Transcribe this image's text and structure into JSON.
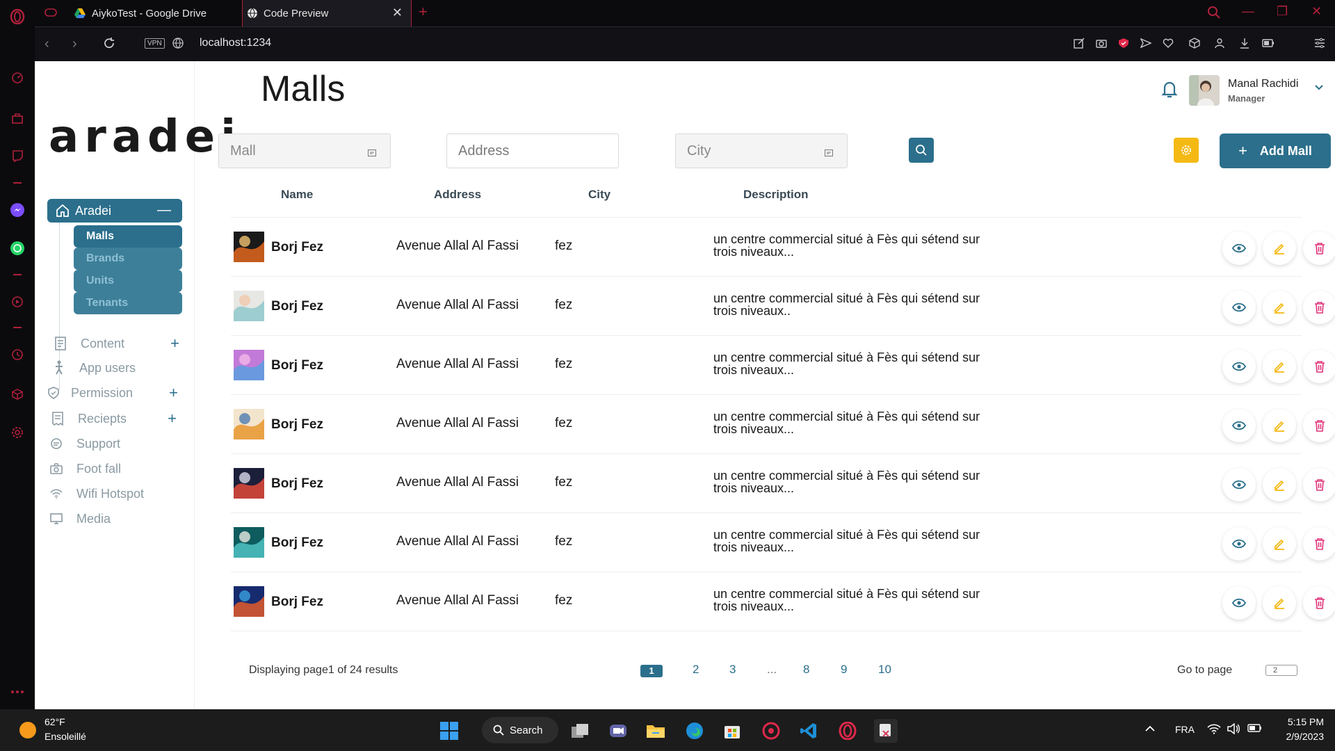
{
  "browser": {
    "tabs": [
      {
        "title": "AiykoTest - Google Drive",
        "active": false
      },
      {
        "title": "Code Preview",
        "active": true
      }
    ],
    "url": "localhost:1234",
    "vpn_label": "VPN"
  },
  "sidebar": {
    "logo": "aradei",
    "parent": {
      "label": "Aradei",
      "collapse": "—"
    },
    "sub_items": [
      {
        "label": "Malls",
        "active": true
      },
      {
        "label": "Brands",
        "active": false
      },
      {
        "label": "Units",
        "active": false
      },
      {
        "label": "Tenants",
        "active": false
      }
    ],
    "menu": [
      {
        "label": "Content",
        "icon": "document-icon",
        "has_plus": true
      },
      {
        "label": "App users",
        "icon": "person-icon",
        "has_plus": false
      },
      {
        "label": "Permission",
        "icon": "shield-icon",
        "has_plus": true
      },
      {
        "label": "Reciepts",
        "icon": "receipt-icon",
        "has_plus": true
      },
      {
        "label": "Support",
        "icon": "chat-icon",
        "has_plus": false
      },
      {
        "label": "Foot fall",
        "icon": "camera-icon",
        "has_plus": false
      },
      {
        "label": "Wifi Hotspot",
        "icon": "wifi-icon",
        "has_plus": false
      },
      {
        "label": "Media",
        "icon": "monitor-icon",
        "has_plus": false
      }
    ],
    "plus": "+"
  },
  "header": {
    "title": "Malls",
    "user_name": "Manal Rachidi",
    "user_role": "Manager"
  },
  "filters": {
    "mall_placeholder": "Mall",
    "address_placeholder": "Address",
    "city_placeholder": "City"
  },
  "toolbar": {
    "add_label": "Add Mall",
    "add_plus": "+"
  },
  "table": {
    "columns": [
      "Name",
      "Address",
      "City",
      "Description"
    ],
    "rows": [
      {
        "name": "Borj Fez",
        "address": "Avenue Allal Al Fassi",
        "city": "fez",
        "description": "un centre commercial situé à Fès qui sétend sur trois niveaux..."
      },
      {
        "name": "Borj Fez",
        "address": "Avenue Allal Al Fassi",
        "city": "fez",
        "description": "un centre commercial situé à Fès qui sétend sur trois niveaux.."
      },
      {
        "name": "Borj Fez",
        "address": "Avenue Allal Al Fassi",
        "city": "fez",
        "description": "un centre commercial situé à Fès qui sétend sur trois niveaux..."
      },
      {
        "name": "Borj Fez",
        "address": "Avenue Allal Al Fassi",
        "city": "fez",
        "description": "un centre commercial situé à Fès qui sétend sur trois niveaux..."
      },
      {
        "name": "Borj Fez",
        "address": "Avenue Allal Al Fassi",
        "city": "fez",
        "description": "un centre commercial situé à Fès qui sétend sur trois niveaux..."
      },
      {
        "name": "Borj Fez",
        "address": "Avenue Allal Al Fassi",
        "city": "fez",
        "description": "un centre commercial situé à Fès qui sétend sur trois niveaux..."
      },
      {
        "name": "Borj Fez",
        "address": "Avenue Allal Al Fassi",
        "city": "fez",
        "description": "un centre commercial situé à Fès qui sétend sur trois niveaux..."
      }
    ]
  },
  "pagination": {
    "info": "Displaying page1 of 24 results",
    "pages": [
      "1",
      "2",
      "3",
      "...",
      "8",
      "9",
      "10"
    ],
    "current": "1",
    "goto_label": "Go to page",
    "goto_value": "2"
  },
  "taskbar": {
    "temperature": "62°F",
    "weather": "Ensoleillé",
    "search_label": "Search",
    "language": "FRA",
    "time": "5:15 PM",
    "date": "2/9/2023"
  },
  "colors": {
    "primary": "#2b6f8c",
    "accent_yellow": "#f5b914",
    "delete_pink": "#e0337a",
    "browser_red": "#b0203a"
  }
}
